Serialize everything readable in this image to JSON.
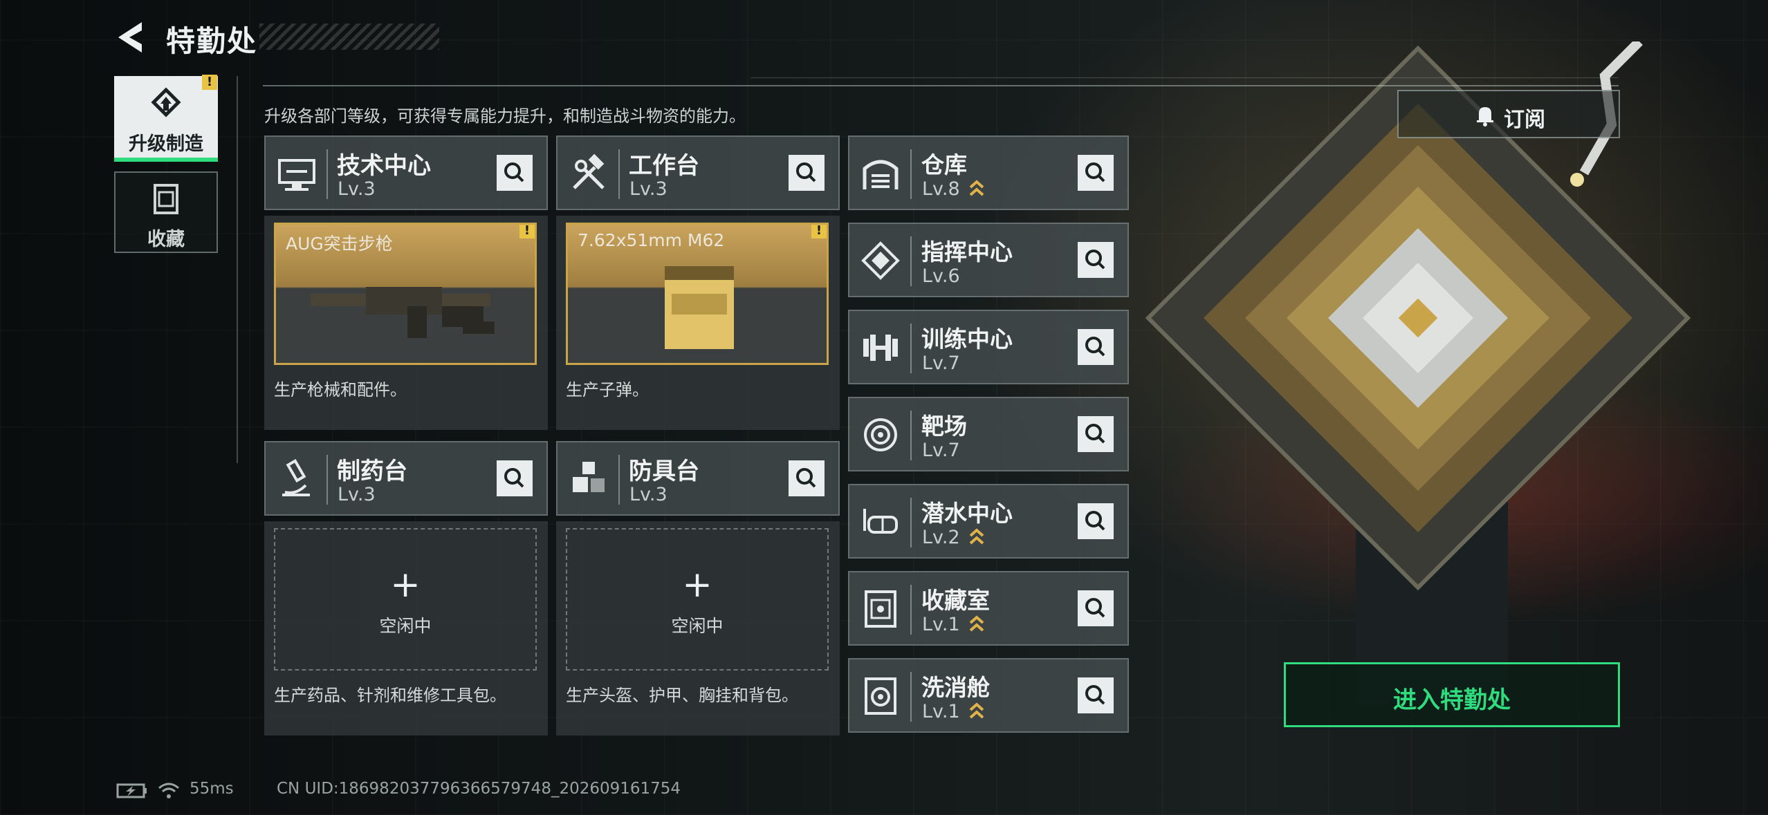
{
  "header": {
    "title": "特勤处"
  },
  "intro": "升级各部门等级，可获得专属能力提升，和制造战斗物资的能力。",
  "sidenav": [
    {
      "label": "升级制造",
      "active": true,
      "alert": "!"
    },
    {
      "label": "收藏",
      "active": false
    }
  ],
  "cards": [
    {
      "name": "技术中心",
      "level": "Lv.3",
      "product": "AUG突击步枪",
      "product_alert": "!",
      "description": "生产枪械和配件。",
      "icon": "monitor-icon"
    },
    {
      "name": "工作台",
      "level": "Lv.3",
      "product": "7.62x51mm M62",
      "product_alert": "!",
      "description": "生产子弹。",
      "icon": "tools-icon"
    },
    {
      "name": "制药台",
      "level": "Lv.3",
      "plus": "+",
      "idle": "空闲中",
      "description": "生产药品、针剂和维修工具包。",
      "icon": "microscope-icon"
    },
    {
      "name": "防具台",
      "level": "Lv.3",
      "plus": "+",
      "idle": "空闲中",
      "description": "生产头盔、护甲、胸挂和背包。",
      "icon": "blocks-icon"
    }
  ],
  "buildings": [
    {
      "name": "仓库",
      "level": "Lv.8",
      "upgradable": true,
      "icon": "warehouse-icon"
    },
    {
      "name": "指挥中心",
      "level": "Lv.6",
      "upgradable": false,
      "icon": "command-icon"
    },
    {
      "name": "训练中心",
      "level": "Lv.7",
      "upgradable": false,
      "icon": "dumbbell-icon"
    },
    {
      "name": "靶场",
      "level": "Lv.7",
      "upgradable": false,
      "icon": "target-icon"
    },
    {
      "name": "潜水中心",
      "level": "Lv.2",
      "upgradable": true,
      "icon": "diving-mask-icon"
    },
    {
      "name": "收藏室",
      "level": "Lv.1",
      "upgradable": true,
      "icon": "collection-icon"
    },
    {
      "name": "洗消舱",
      "level": "Lv.1",
      "upgradable": true,
      "icon": "decon-icon"
    }
  ],
  "subscribe": {
    "label": "订阅"
  },
  "enter_button": {
    "label": "进入特勤处"
  },
  "footer": {
    "ping": "55ms",
    "uid": "CN UID:18698203779636657974​8_202609161754"
  },
  "colors": {
    "accent_green": "#2fdc7e",
    "gold": "#c9a448",
    "alert_yellow": "#e9c444"
  }
}
